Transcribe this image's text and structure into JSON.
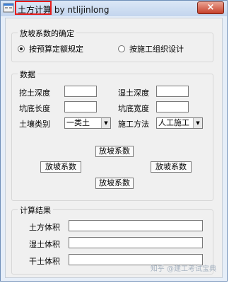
{
  "window": {
    "title_highlighted": "土方计算",
    "title_rest": "by ntlijinlong",
    "close_symbol": "×"
  },
  "rules_group": {
    "title": "放坡系数的确定",
    "options": [
      {
        "label": "按预算定额规定",
        "checked": true
      },
      {
        "label": "按施工组织设计",
        "checked": false
      }
    ]
  },
  "data_group": {
    "title": "数据",
    "fields": {
      "excavation_depth": {
        "label": "挖土深度",
        "value": ""
      },
      "wet_soil_depth": {
        "label": "湿土深度",
        "value": ""
      },
      "pit_length": {
        "label": "坑底长度",
        "value": ""
      },
      "pit_width": {
        "label": "坑底宽度",
        "value": ""
      }
    },
    "soil_type": {
      "label": "土壤类别",
      "value": "一类土"
    },
    "construction_method": {
      "label": "施工方法",
      "value": "人工施工"
    },
    "slope_buttons": [
      "放坡系数",
      "放坡系数",
      "放坡系数",
      "放坡系数"
    ]
  },
  "results_group": {
    "title": "计算结果",
    "fields": [
      {
        "label": "土方体积",
        "value": ""
      },
      {
        "label": "湿土体积",
        "value": ""
      },
      {
        "label": "干土体积",
        "value": ""
      }
    ]
  },
  "watermark": "知乎 @建工考试宝典",
  "colors": {
    "highlight_border": "#e51c1c",
    "close_button": "#c7402b",
    "window_border": "#6f8fb8"
  }
}
